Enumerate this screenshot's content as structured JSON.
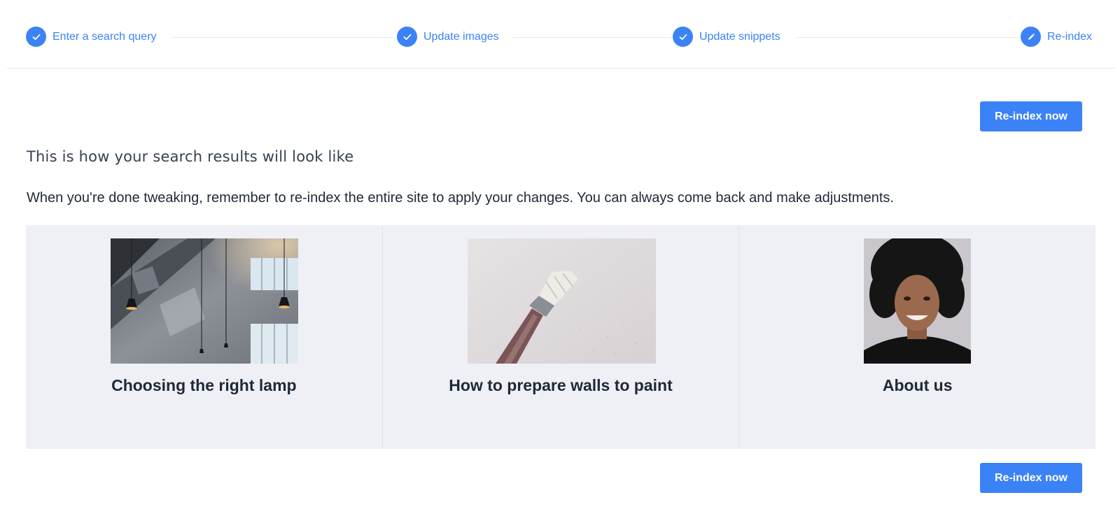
{
  "stepper": {
    "steps": [
      {
        "label": "Enter a search query",
        "state": "done",
        "icon": "check-icon"
      },
      {
        "label": "Update images",
        "state": "done",
        "icon": "check-icon"
      },
      {
        "label": "Update snippets",
        "state": "done",
        "icon": "check-icon"
      },
      {
        "label": "Re-index",
        "state": "current",
        "icon": "pencil-icon"
      }
    ]
  },
  "actions": {
    "reindex_top_label": "Re-index now",
    "reindex_bottom_label": "Re-index now"
  },
  "content": {
    "heading": "This is how your search results will look like",
    "description": "When you're done tweaking, remember to re-index the entire site to apply your changes. You can always come back and make adjustments."
  },
  "results": [
    {
      "title": "Choosing the right lamp",
      "image": "lamp-interior-photo"
    },
    {
      "title": "How to prepare walls to paint",
      "image": "paintbrush-photo"
    },
    {
      "title": "About us",
      "image": "portrait-photo"
    }
  ],
  "colors": {
    "accent": "#3b82f6",
    "panel_background": "#eff0f5",
    "divider": "#e5e7eb"
  }
}
